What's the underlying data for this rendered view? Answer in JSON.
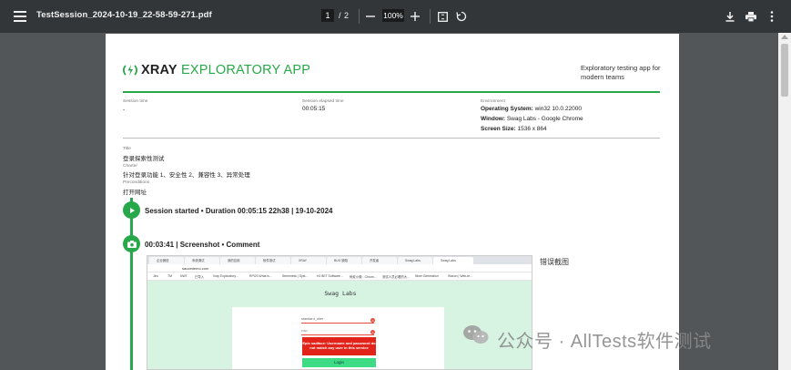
{
  "toolbar": {
    "title": "TestSession_2024-10-19_22-58-59-271.pdf",
    "current_page": "1",
    "page_separator": "/",
    "total_pages": "2",
    "zoom": "100%"
  },
  "report": {
    "logo_brand": "XRAY",
    "logo_product": "EXPLORATORY APP",
    "tagline": "Exploratory testing app for modern teams",
    "session_time_label": "Session time",
    "session_time_value": "-",
    "elapsed_label": "Session elapsed time",
    "elapsed_value": "00:05:15",
    "environment_label": "Environment",
    "os_label": "Operating System:",
    "os_value": "win32 10.0.22000",
    "window_label": "Window:",
    "window_value": "Swag Labs - Google Chrome",
    "screen_label": "Screen Size:",
    "screen_value": "1536 x 864",
    "title_label": "Title",
    "title_value": "登录探索性测试",
    "charter_label": "Charter",
    "charter_value": "针对登录功能 1、安全性 2、兼容性 3、异常处理",
    "preconditions_label": "Preconditions",
    "preconditions_value": "打开网址",
    "event1": "Session started • Duration 00:05:15 22h38 | 19-10-2024",
    "event2": "00:03:41 | Screenshot • Comment",
    "comment": "错误截图"
  },
  "screenshot": {
    "tabs": [
      "企业微信",
      "系统调试",
      "我的应用",
      "软件测试",
      "XRAY",
      "BUG 缺陷",
      "开发者",
      "Swag Labs",
      "Swag Labs"
    ],
    "url": "saucedemo.com",
    "bookmarks": [
      "Jira",
      "TM",
      "NWT",
      "已导入",
      "Xray Exploratory...",
      "RPOS What is...",
      "Stemmetic | Syst...",
      "HJ BET Software...",
      "蚂蚁小微 - Chrom...",
      "测试人员必看的大...",
      "Nicer Generation",
      "Xtacon | Web-te..."
    ],
    "app_title": "Swag Labs",
    "username": "standard_user",
    "password": "•••••",
    "error": "Epic sadface: Username and password do not match any user in this service",
    "login": "Login"
  },
  "watermark": "公众号 · AllTests软件测试",
  "colors": {
    "accent": "#27a84a",
    "toolbar": "#323639",
    "viewer": "#525659",
    "error": "#e2231a",
    "login": "#3ddc84"
  },
  "icons": [
    "menu-icon",
    "zoom-out-icon",
    "zoom-in-icon",
    "fit-page-icon",
    "rotate-icon",
    "download-icon",
    "print-icon",
    "more-icon",
    "play-icon",
    "camera-icon",
    "wechat-icon"
  ]
}
